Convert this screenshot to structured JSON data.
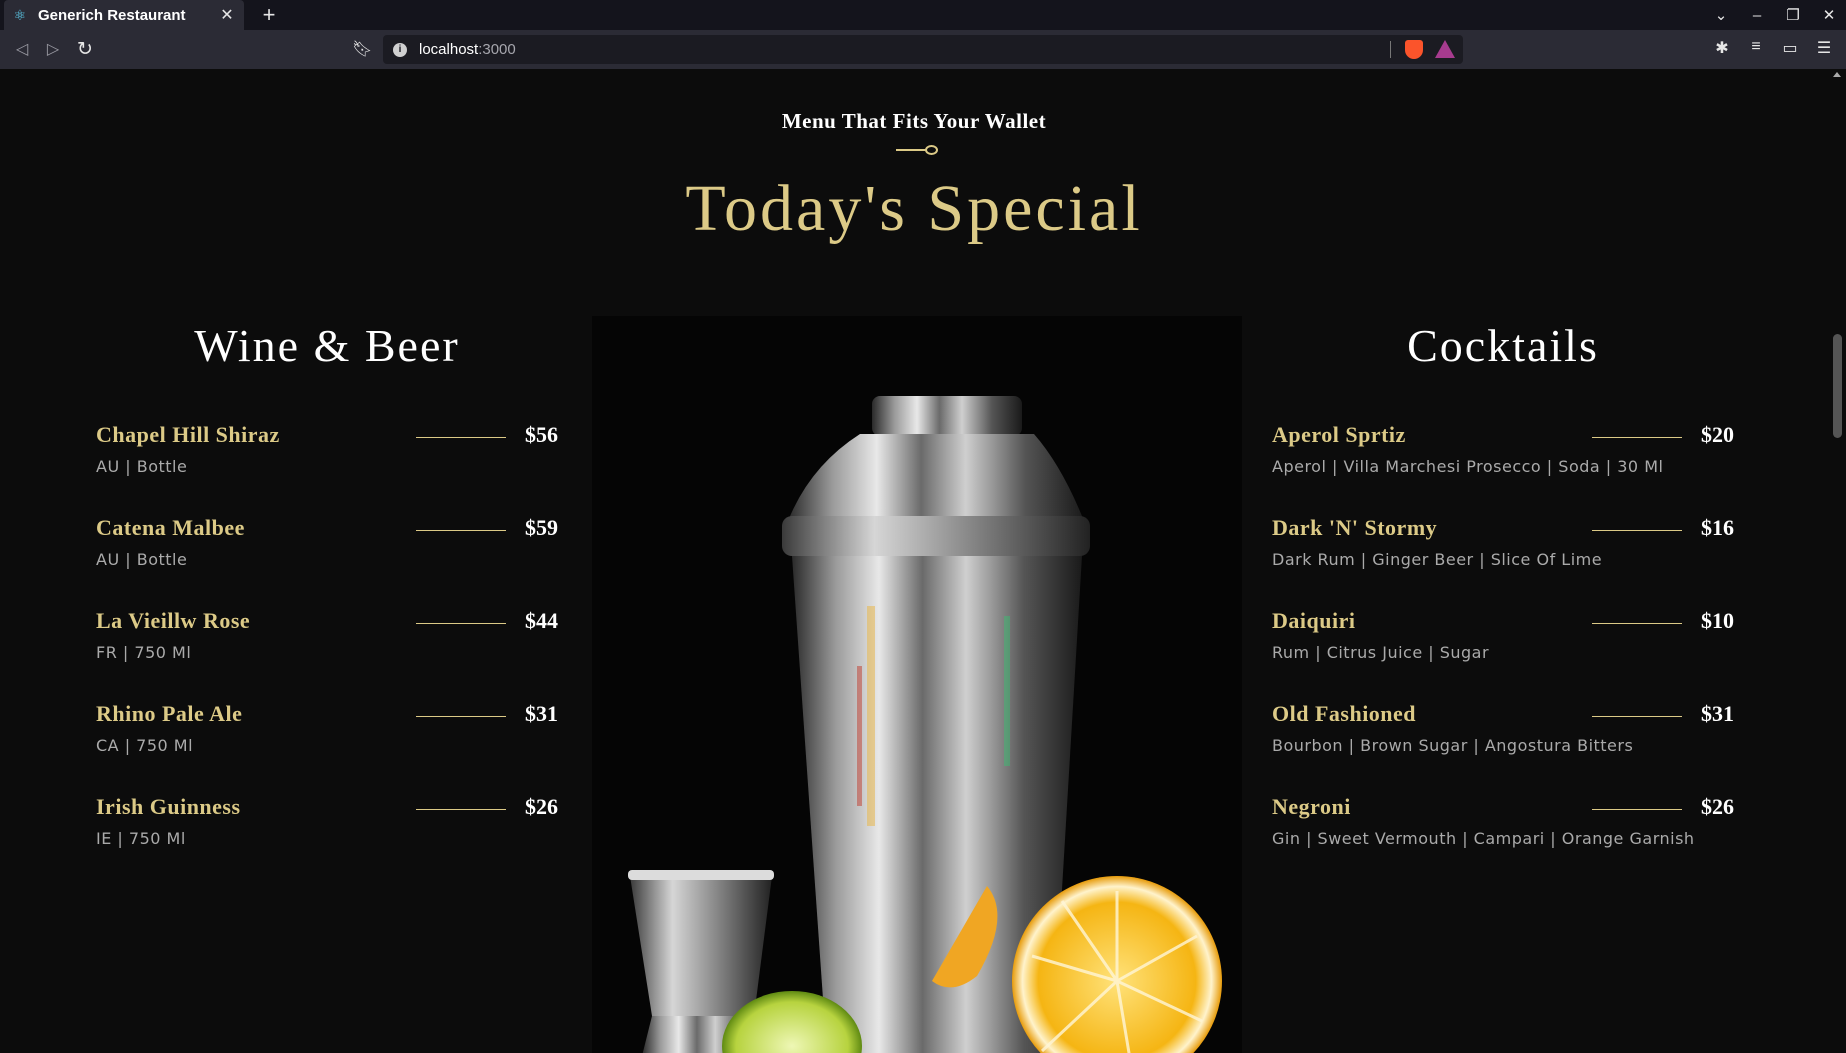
{
  "browser": {
    "tab_title": "Generich Restaurant",
    "url_host": "localhost",
    "url_port": ":3000"
  },
  "page": {
    "subtitle": "Menu That Fits Your Wallet",
    "headline": "Today's Special",
    "accent_color": "#dcca87",
    "background_color": "#0c0c0c",
    "wine_beer": {
      "title": "Wine & Beer",
      "items": [
        {
          "name": "Chapel Hill Shiraz",
          "price": "$56",
          "desc": "AU | Bottle"
        },
        {
          "name": "Catena Malbee",
          "price": "$59",
          "desc": "AU | Bottle"
        },
        {
          "name": "La Vieillw Rose",
          "price": "$44",
          "desc": "FR | 750 Ml"
        },
        {
          "name": "Rhino Pale Ale",
          "price": "$31",
          "desc": "CA | 750 Ml"
        },
        {
          "name": "Irish Guinness",
          "price": "$26",
          "desc": "IE | 750 Ml"
        }
      ]
    },
    "cocktails": {
      "title": "Cocktails",
      "items": [
        {
          "name": "Aperol Sprtiz",
          "price": "$20",
          "desc": "Aperol | Villa Marchesi Prosecco | Soda | 30 Ml"
        },
        {
          "name": "Dark 'N' Stormy",
          "price": "$16",
          "desc": "Dark Rum | Ginger Beer | Slice Of Lime"
        },
        {
          "name": "Daiquiri",
          "price": "$10",
          "desc": "Rum | Citrus Juice | Sugar"
        },
        {
          "name": "Old Fashioned",
          "price": "$31",
          "desc": "Bourbon | Brown Sugar | Angostura Bitters"
        },
        {
          "name": "Negroni",
          "price": "$26",
          "desc": "Gin | Sweet Vermouth | Campari | Orange Garnish"
        }
      ]
    }
  }
}
